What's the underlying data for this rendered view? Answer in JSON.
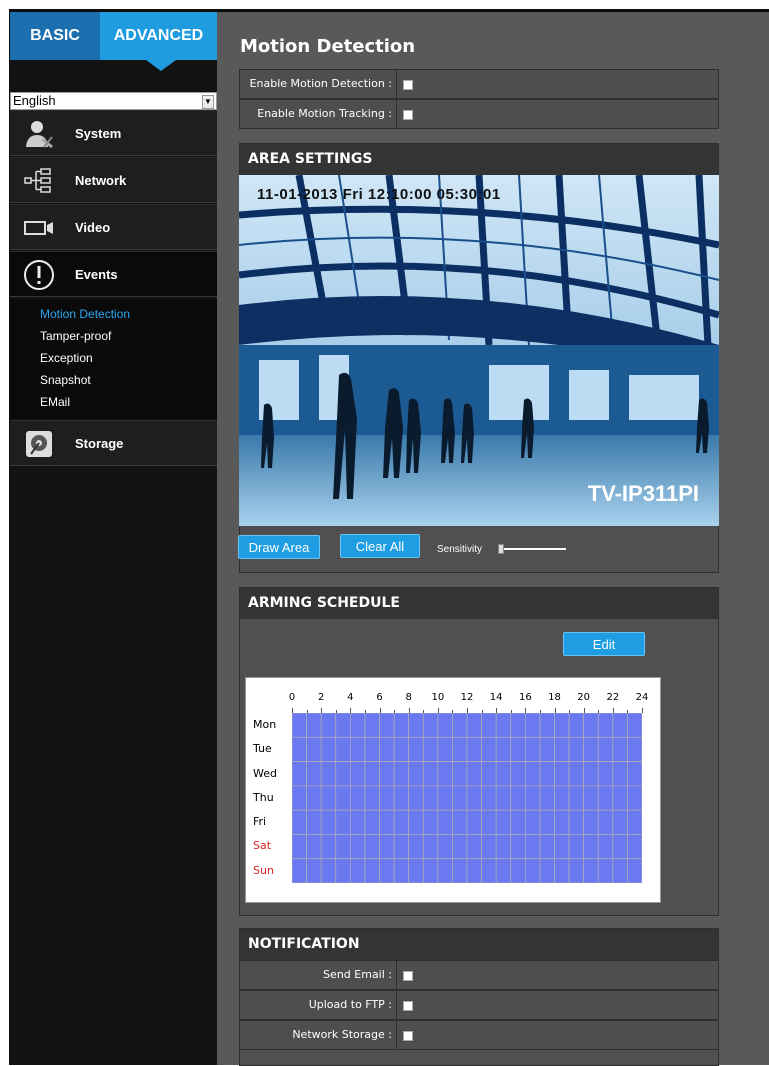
{
  "tabs": {
    "basic": "BASIC",
    "advanced": "ADVANCED"
  },
  "language": {
    "selected": "English"
  },
  "menu": [
    {
      "label": "System",
      "icon": "user-settings-icon"
    },
    {
      "label": "Network",
      "icon": "network-tree-icon"
    },
    {
      "label": "Video",
      "icon": "video-camera-icon"
    },
    {
      "label": "Events",
      "icon": "alert-icon"
    },
    {
      "label": "Storage",
      "icon": "storage-disk-icon"
    }
  ],
  "submenu": [
    "Motion Detection",
    "Tamper-proof",
    "Exception",
    "Snapshot",
    "EMail"
  ],
  "page": {
    "title": "Motion Detection",
    "enable_motion": "Enable Motion Detection :",
    "enable_tracking": "Enable Motion Tracking :"
  },
  "area": {
    "title": "AREA SETTINGS",
    "timestamp": "11-01-2013 Fri 12:10:00 05:30:01",
    "model": "TV-IP311PI",
    "draw_area": "Draw Area",
    "clear_all": "Clear All",
    "sensitivity": "Sensitivity"
  },
  "schedule": {
    "title": "ARMING SCHEDULE",
    "edit": "Edit",
    "hours": [
      "0",
      "2",
      "4",
      "6",
      "8",
      "10",
      "12",
      "14",
      "16",
      "18",
      "20",
      "22",
      "24"
    ],
    "days": [
      "Mon",
      "Tue",
      "Wed",
      "Thu",
      "Fri",
      "Sat",
      "Sun"
    ],
    "weekend_color": "#e22222",
    "fill_color": "#6b79f0"
  },
  "notification": {
    "title": "NOTIFICATION",
    "send_email": "Send Email :",
    "upload_ftp": "Upload to FTP :",
    "network_storage": "Network  Storage :"
  },
  "colors": {
    "accent": "#1f9be0",
    "active_link": "#2ea8f0"
  }
}
